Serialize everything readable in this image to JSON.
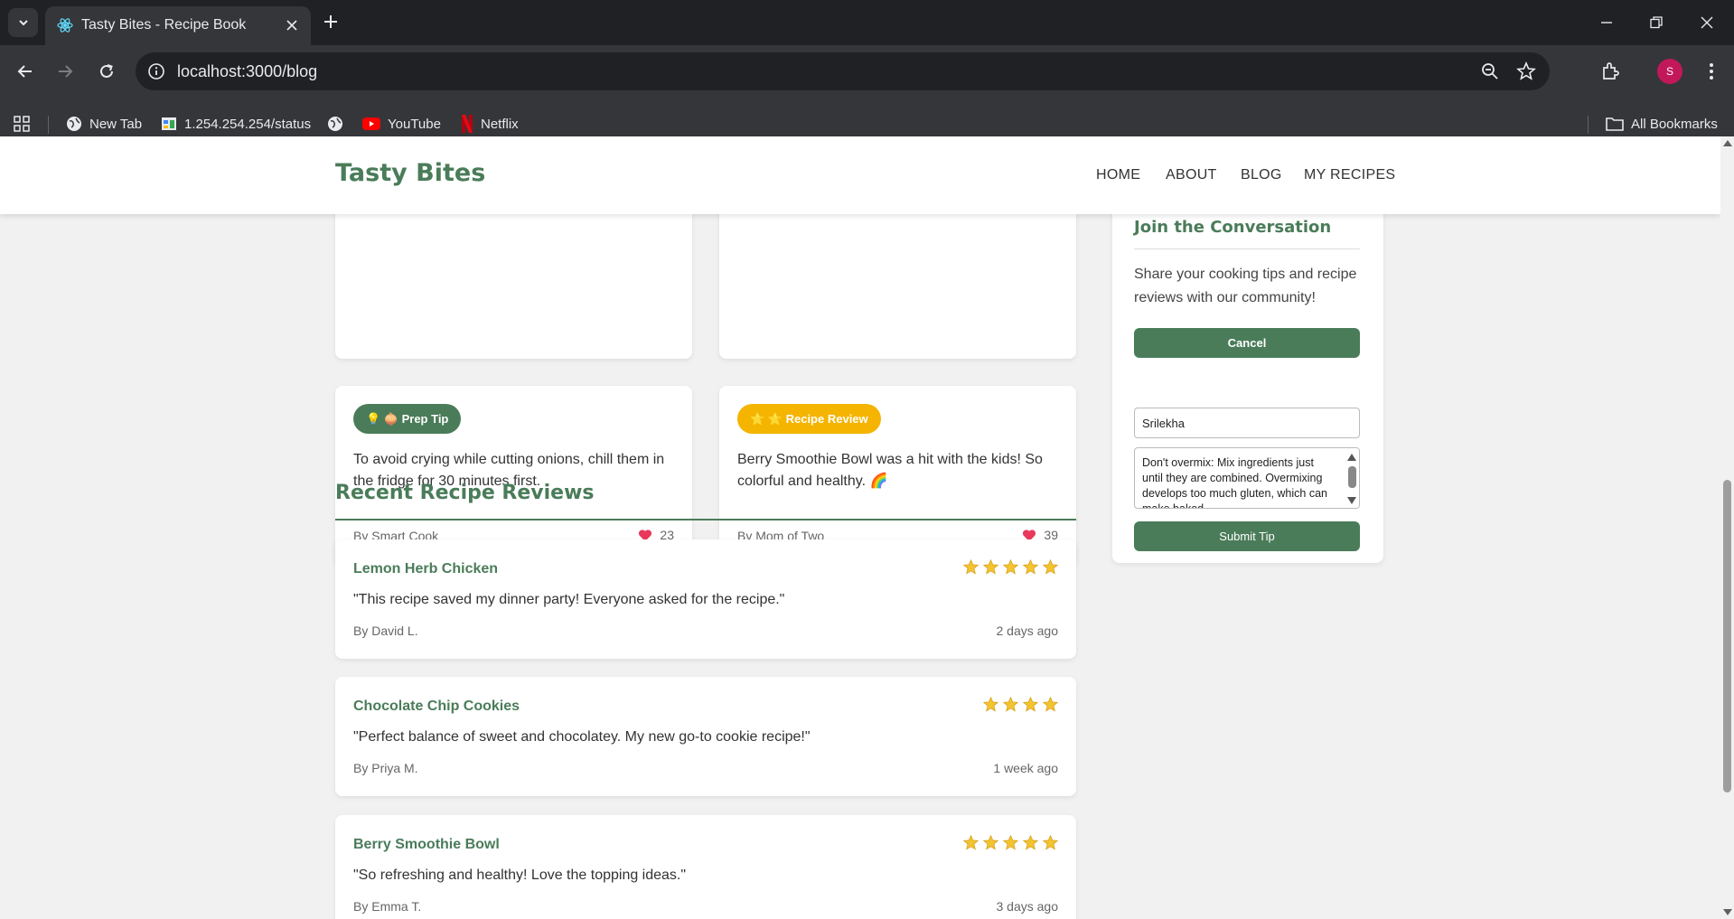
{
  "browser": {
    "tab_title": "Tasty Bites - Recipe Book",
    "url": "localhost:3000/blog",
    "profile_initial": "S",
    "bookmarks": [
      {
        "label": "New Tab",
        "icon": "globe-icon"
      },
      {
        "label": "1.254.254.254/status",
        "icon": "router-icon"
      },
      {
        "label": "",
        "icon": "globe-icon"
      },
      {
        "label": "YouTube",
        "icon": "youtube-icon"
      },
      {
        "label": "Netflix",
        "icon": "netflix-icon"
      }
    ],
    "all_bookmarks": "All Bookmarks"
  },
  "site": {
    "logo": "Tasty Bites",
    "nav": [
      "HOME",
      "ABOUT",
      "BLOG",
      "MY RECIPES"
    ],
    "brand_color": "#4a7c59"
  },
  "tips": [
    {
      "badge": "💡 🧅 Prep Tip",
      "badge_color": "#4a7c59",
      "text": "To avoid crying while cutting onions, chill them in the fridge for 30 minutes first.",
      "author": "By Smart Cook",
      "likes": "23"
    },
    {
      "badge": "⭐ ⭐ Recipe Review",
      "badge_color": "#f4b400",
      "text": "Berry Smoothie Bowl was a hit with the kids! So colorful and healthy. 🌈",
      "author": "By Mom of Two",
      "likes": "39"
    }
  ],
  "reviews_section": {
    "title": "Recent Recipe Reviews",
    "reviews": [
      {
        "title": "Lemon Herb Chicken",
        "stars": 5,
        "text": "\"This recipe saved my dinner party! Everyone asked for the recipe.\"",
        "author": "By David L.",
        "date": "2 days ago"
      },
      {
        "title": "Chocolate Chip Cookies",
        "stars": 4,
        "text": "\"Perfect balance of sweet and chocolatey. My new go-to cookie recipe!\"",
        "author": "By Priya M.",
        "date": "1 week ago"
      },
      {
        "title": "Berry Smoothie Bowl",
        "stars": 5,
        "text": "\"So refreshing and healthy! Love the topping ideas.\"",
        "author": "By Emma T.",
        "date": "3 days ago"
      }
    ]
  },
  "sidebar": {
    "title": "Join the Conversation",
    "description": "Share your cooking tips and recipe reviews with our community!",
    "cancel_label": "Cancel",
    "name_value": "Srilekha",
    "tip_value": "Don't overmix: Mix ingredients just until they are combined. Overmixing develops too much gluten, which can make baked",
    "submit_label": "Submit Tip"
  }
}
